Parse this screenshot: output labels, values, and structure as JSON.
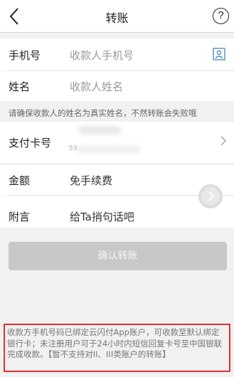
{
  "header": {
    "title": "转账",
    "help_symbol": "?"
  },
  "form": {
    "phone": {
      "label": "手机号",
      "placeholder": "收款人手机号"
    },
    "name": {
      "label": "姓名",
      "placeholder": "收款人姓名"
    },
    "tip": "请确保收款人的姓名为真实姓名，不然转账会失败哦",
    "card": {
      "label": "支付卡号",
      "masked_small": "53"
    },
    "amount": {
      "label": "金额",
      "value": "免手续费"
    },
    "note": {
      "label": "附言",
      "value": "给Ta捎句话吧"
    }
  },
  "confirm_button": "确认转账",
  "notice": "收款方手机号码已绑定云闪付App账户，可收款至默认绑定银行卡；未注册用户可于24小时内短信回复卡号至中国银联完成收款。【暂不支持对II、III类账户的转账】",
  "colors": {
    "highlight_border": "#e03030",
    "disabled_button": "#c8c8c8"
  }
}
